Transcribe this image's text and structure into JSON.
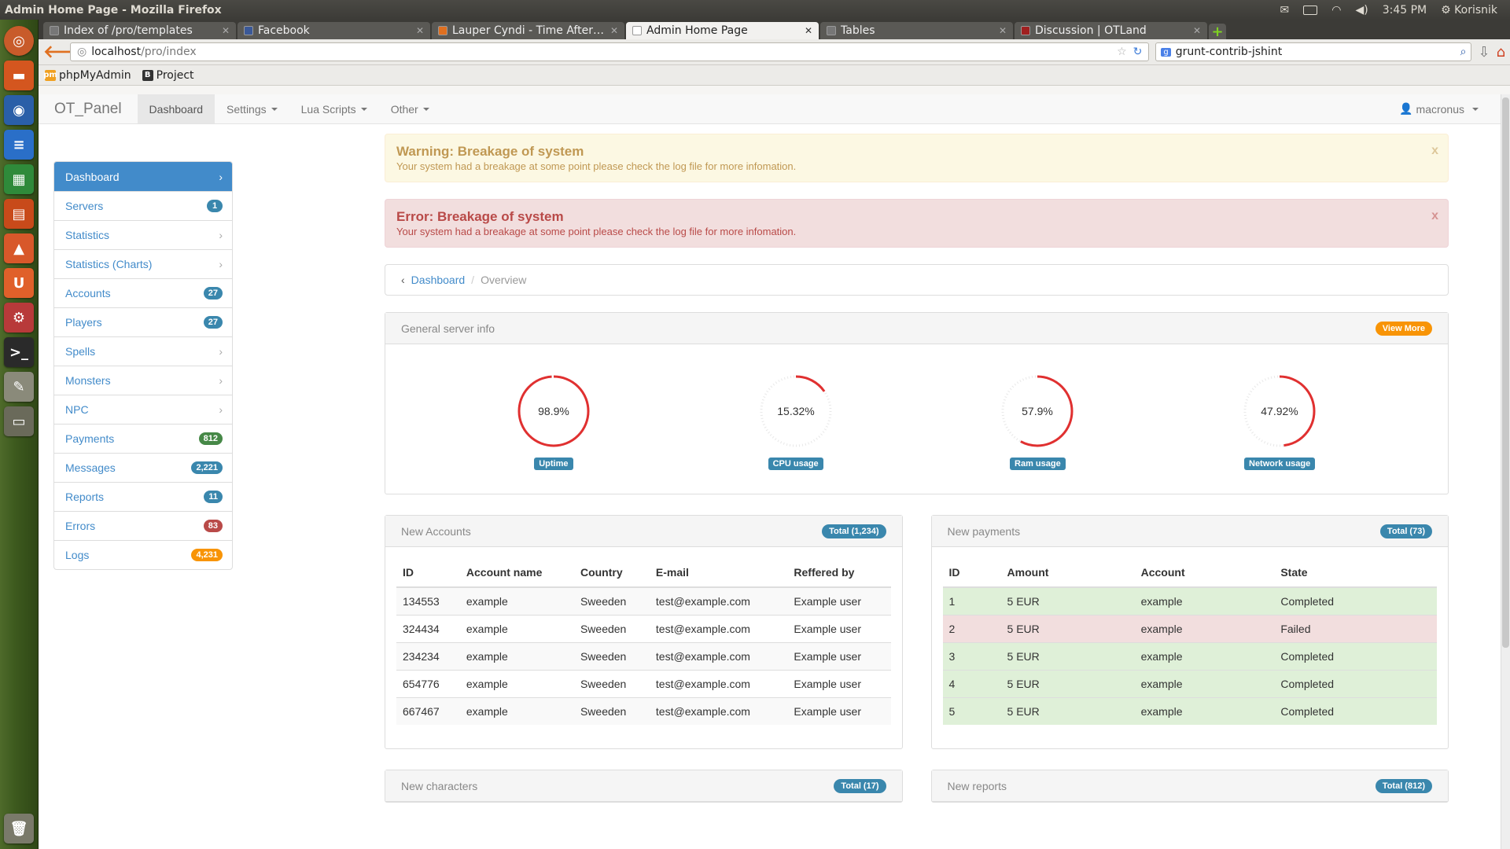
{
  "os": {
    "window_title": "Admin Home Page - Mozilla Firefox",
    "clock": "3:45 PM",
    "user": "Korisnik"
  },
  "browser": {
    "tabs": [
      {
        "title": "Index of /pro/templates",
        "active": false,
        "color": "#777777"
      },
      {
        "title": "Facebook",
        "active": false,
        "color": "#3b5998"
      },
      {
        "title": "Lauper Cyndi - Time After Ti…",
        "active": false,
        "color": "#e07020"
      },
      {
        "title": "Admin Home Page",
        "active": true,
        "color": "#ffffff"
      },
      {
        "title": "Tables",
        "active": false,
        "color": "#777777"
      },
      {
        "title": "Discussion | OTLand",
        "active": false,
        "color": "#a02020"
      }
    ],
    "url_host": "localhost",
    "url_path": "/pro/index",
    "search_value": "grunt-contrib-jshint",
    "bookmarks": [
      {
        "label": "phpMyAdmin",
        "icon": "pma-icon"
      },
      {
        "label": "Project",
        "icon": "bootstrap-icon"
      }
    ]
  },
  "app": {
    "brand": "OT_Panel",
    "nav": [
      {
        "label": "Dashboard",
        "active": true,
        "dropdown": false
      },
      {
        "label": "Settings",
        "active": false,
        "dropdown": true
      },
      {
        "label": "Lua Scripts",
        "active": false,
        "dropdown": true
      },
      {
        "label": "Other",
        "active": false,
        "dropdown": true
      }
    ],
    "user": "macronus"
  },
  "sidebar": {
    "items": [
      {
        "label": "Dashboard",
        "badge": "",
        "active": true
      },
      {
        "label": "Servers",
        "badge": "1",
        "badge_color": "#3a87ad"
      },
      {
        "label": "Statistics",
        "badge": ""
      },
      {
        "label": "Statistics (Charts)",
        "badge": ""
      },
      {
        "label": "Accounts",
        "badge": "27",
        "badge_color": "#3a87ad"
      },
      {
        "label": "Players",
        "badge": "27",
        "badge_color": "#3a87ad"
      },
      {
        "label": "Spells",
        "badge": ""
      },
      {
        "label": "Monsters",
        "badge": ""
      },
      {
        "label": "NPC",
        "badge": ""
      },
      {
        "label": "Payments",
        "badge": "812",
        "badge_color": "#468847"
      },
      {
        "label": "Messages",
        "badge": "2,221",
        "badge_color": "#3a87ad"
      },
      {
        "label": "Reports",
        "badge": "11",
        "badge_color": "#3a87ad"
      },
      {
        "label": "Errors",
        "badge": "83",
        "badge_color": "#b94a48"
      },
      {
        "label": "Logs",
        "badge": "4,231",
        "badge_color": "#f89406"
      }
    ]
  },
  "alerts": {
    "warning": {
      "title": "Warning: Breakage of system",
      "text": "Your system had a breakage at some point please check the log file for more infomation.",
      "close": "x"
    },
    "error": {
      "title": "Error: Breakage of system",
      "text": "Your system had a breakage at some point please check the log file for more infomation.",
      "close": "x"
    }
  },
  "breadcrumb": {
    "home": "Dashboard",
    "separator": "/",
    "current": "Overview"
  },
  "server_info": {
    "title": "General server info",
    "button": "View More",
    "gauges": [
      {
        "label": "Uptime",
        "value_text": "98.9%",
        "value": 98.9
      },
      {
        "label": "CPU usage",
        "value_text": "15.32%",
        "value": 15.32
      },
      {
        "label": "Ram usage",
        "value_text": "57.9%",
        "value": 57.9
      },
      {
        "label": "Network usage",
        "value_text": "47.92%",
        "value": 47.92
      }
    ]
  },
  "accounts": {
    "title": "New Accounts",
    "total": "Total (1,234)",
    "columns": [
      "ID",
      "Account name",
      "Country",
      "E-mail",
      "Reffered by"
    ],
    "rows": [
      [
        "134553",
        "example",
        "Sweeden",
        "test@example.com",
        "Example user"
      ],
      [
        "324434",
        "example",
        "Sweeden",
        "test@example.com",
        "Example user"
      ],
      [
        "234234",
        "example",
        "Sweeden",
        "test@example.com",
        "Example user"
      ],
      [
        "654776",
        "example",
        "Sweeden",
        "test@example.com",
        "Example user"
      ],
      [
        "667467",
        "example",
        "Sweeden",
        "test@example.com",
        "Example user"
      ]
    ]
  },
  "payments": {
    "title": "New payments",
    "total": "Total (73)",
    "columns": [
      "ID",
      "Amount",
      "Account",
      "State"
    ],
    "rows": [
      [
        "1",
        "5 EUR",
        "example",
        "Completed"
      ],
      [
        "2",
        "5 EUR",
        "example",
        "Failed"
      ],
      [
        "3",
        "5 EUR",
        "example",
        "Completed"
      ],
      [
        "4",
        "5 EUR",
        "example",
        "Completed"
      ],
      [
        "5",
        "5 EUR",
        "example",
        "Completed"
      ]
    ]
  },
  "characters": {
    "title": "New characters",
    "total": "Total (17)"
  },
  "reports": {
    "title": "New reports",
    "total": "Total (812)"
  },
  "colors": {
    "gauge": "#e03030",
    "primary": "#428bca"
  }
}
